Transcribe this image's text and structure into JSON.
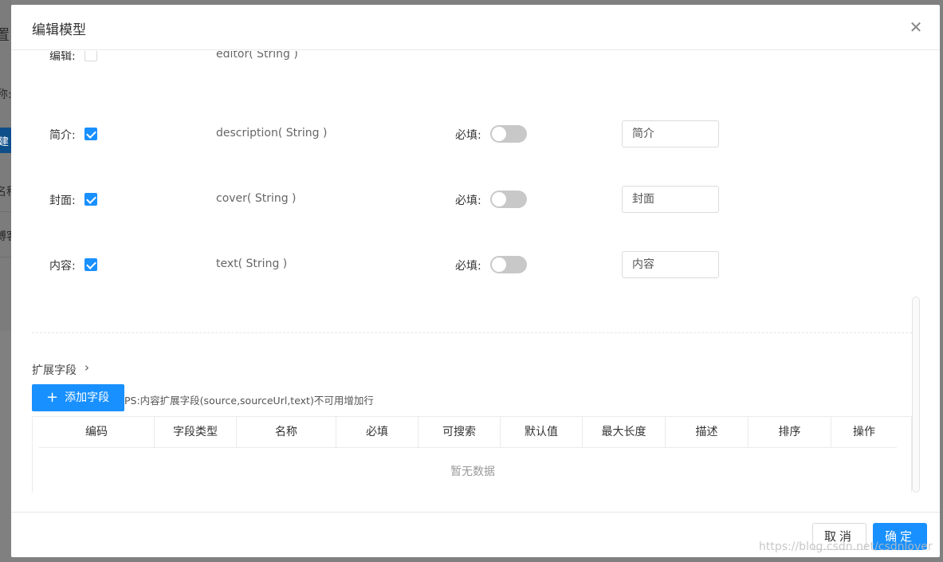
{
  "background": {
    "fragments": [
      "置",
      "称:",
      "建",
      "名称",
      "博客"
    ]
  },
  "modal": {
    "title": "编辑模型",
    "close_icon": "close-icon",
    "partial_row": {
      "label": "编辑:",
      "field": "editor( String )"
    },
    "fields": [
      {
        "label": "简介:",
        "checked": true,
        "field": "description( String )",
        "required_label": "必填:",
        "required": false,
        "input_value": "简介"
      },
      {
        "label": "封面:",
        "checked": true,
        "field": "cover( String )",
        "required_label": "必填:",
        "required": false,
        "input_value": "封面"
      },
      {
        "label": "内容:",
        "checked": true,
        "field": "text( String )",
        "required_label": "必填:",
        "required": false,
        "input_value": "内容"
      }
    ],
    "extension": {
      "title": "扩展字段",
      "chevron_icon": "chevron-right-icon",
      "add_button": "添加字段",
      "note": "PS:内容扩展字段(source,sourceUrl,text)不可用增加行",
      "columns": [
        "编码",
        "字段类型",
        "名称",
        "必填",
        "可搜索",
        "默认值",
        "最大长度",
        "描述",
        "排序",
        "操作"
      ],
      "empty_text": "暂无数据"
    },
    "footer": {
      "cancel": "取消",
      "ok": "确定"
    }
  },
  "watermark": "https://blog.csdn.net/csdnlover"
}
